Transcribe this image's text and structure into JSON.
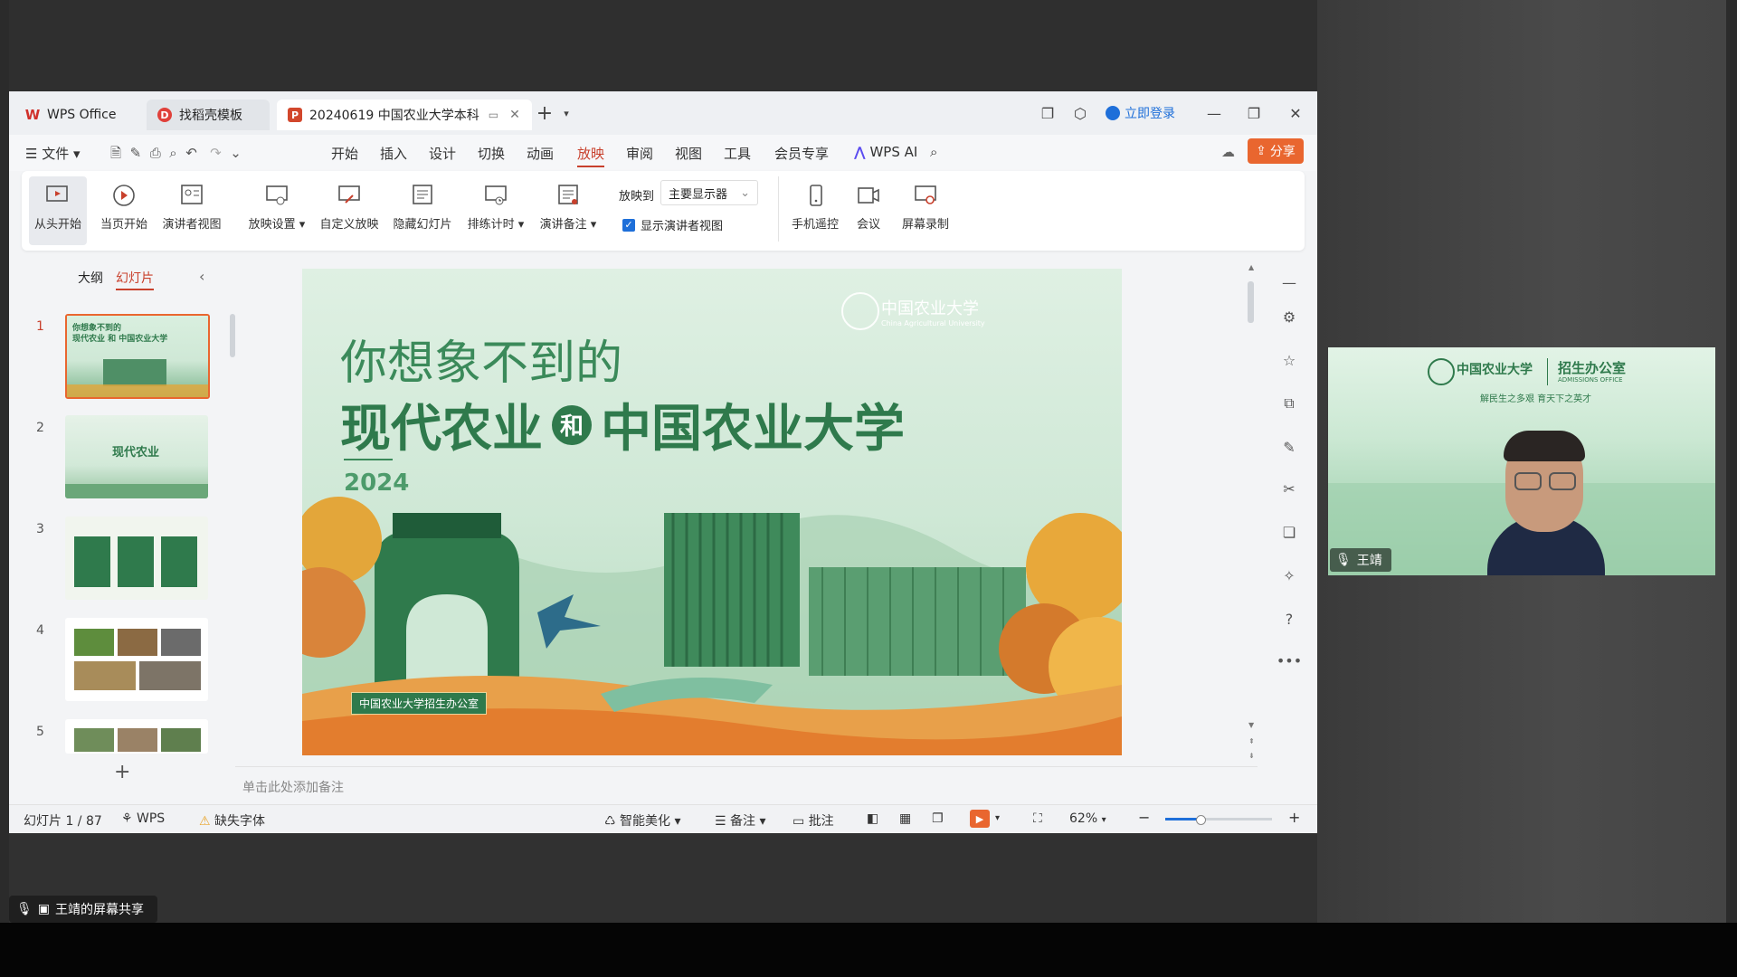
{
  "tabs": {
    "wps_home": "WPS Office",
    "template": "找稻壳模板",
    "document": "20240619 中国农业大学本科"
  },
  "titlebar": {
    "login": "立即登录"
  },
  "menu": {
    "file": "文件",
    "items": [
      "开始",
      "插入",
      "设计",
      "切换",
      "动画",
      "放映",
      "审阅",
      "视图",
      "工具",
      "会员专享"
    ],
    "wps_ai": "WPS AI",
    "share": "分享"
  },
  "ribbon": {
    "from_start": "从头开始",
    "from_current": "当页开始",
    "presenter_view": "演讲者视图",
    "show_settings": "放映设置",
    "custom_show": "自定义放映",
    "hide_slide": "隐藏幻灯片",
    "rehearse": "排练计时",
    "speaker_notes": "演讲备注",
    "play_to_label": "放映到",
    "display_select": "主要显示器",
    "show_presenter_checkbox": "显示演讲者视图",
    "phone_remote": "手机遥控",
    "meeting": "会议",
    "screen_record": "屏幕录制"
  },
  "leftpanel": {
    "tab_outline": "大纲",
    "tab_slides": "幻灯片",
    "slide_numbers": [
      "1",
      "2",
      "3",
      "4",
      "5"
    ],
    "add": "+"
  },
  "slide": {
    "university_logo_text": "中国农业大学",
    "university_logo_en": "China Agricultural University",
    "title_line1": "你想象不到的",
    "title_line2a": "现代农业",
    "title_connector": "和",
    "title_line2b": "中国农业大学",
    "year": "2024",
    "badge": "中国农业大学招生办公室"
  },
  "notes": {
    "placeholder": "单击此处添加备注"
  },
  "status": {
    "slide_counter": "幻灯片 1 / 87",
    "theme": "WPS",
    "missing_font": "缺失字体",
    "beautify": "智能美化",
    "notes": "备注",
    "comments": "批注",
    "zoom": "62%",
    "zoom_fraction": 0.32
  },
  "video": {
    "banner_school": "中国农业大学",
    "banner_office": "招生办公室",
    "banner_office_en": "ADMISSIONS OFFICE",
    "banner_slogan": "解民生之多艰 育天下之英才",
    "speaker_name": "王靖"
  },
  "screen_share_label": "王靖的屏幕共享",
  "colors": {
    "accent_red": "#c8402c",
    "share_orange": "#e9662f",
    "slide_green": "#2f7a4c",
    "slide_bg": "#cfe8d6"
  }
}
